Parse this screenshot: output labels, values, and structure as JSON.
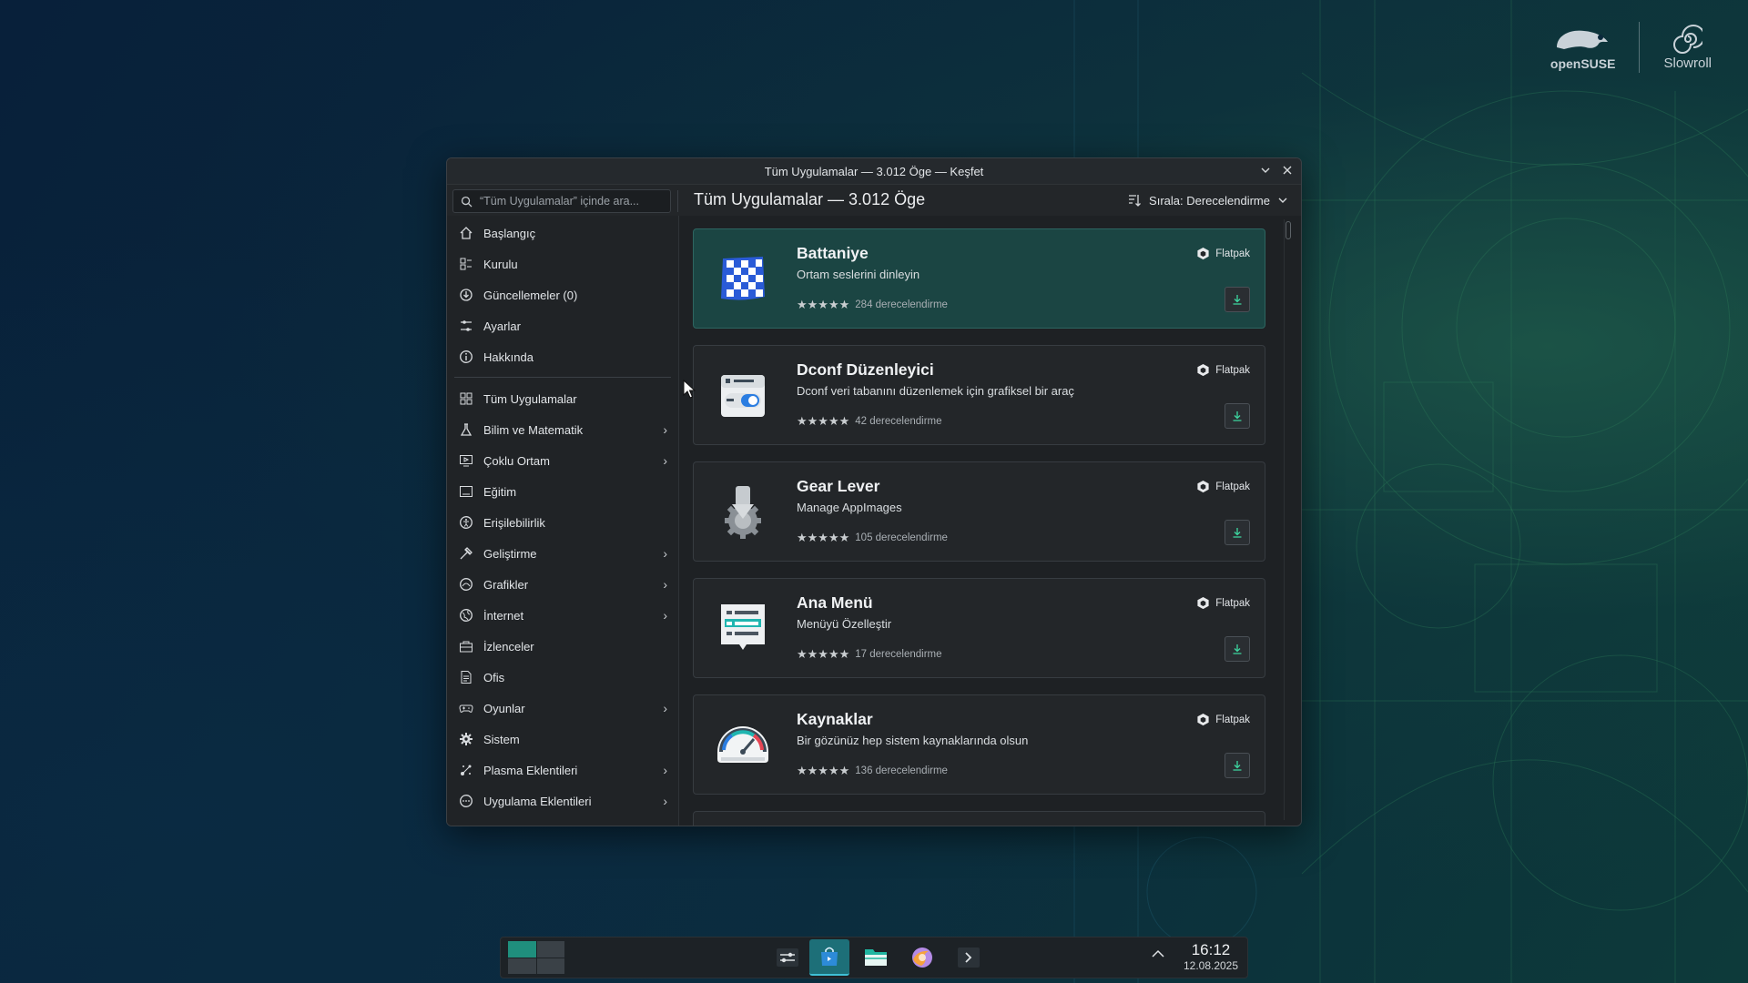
{
  "desktop": {
    "brand": {
      "opensuse": "openSUSE",
      "slowroll": "Slowroll"
    }
  },
  "window": {
    "title": "Tüm Uygulamalar — 3.012 Öge — Keşfet",
    "search_placeholder": "“Tüm Uygulamalar” içinde ara...",
    "heading": "Tüm Uygulamalar — 3.012 Öge",
    "sort_label": "Sırala: Derecelendirme"
  },
  "sidebar": {
    "top": [
      {
        "label": "Başlangıç",
        "icon": "home-icon"
      },
      {
        "label": "Kurulu",
        "icon": "installed-icon"
      },
      {
        "label": "Güncellemeler (0)",
        "icon": "updates-icon"
      },
      {
        "label": "Ayarlar",
        "icon": "settings-icon"
      },
      {
        "label": "Hakkında",
        "icon": "info-icon"
      }
    ],
    "categories": [
      {
        "label": "Tüm Uygulamalar",
        "icon": "grid-icon",
        "has_children": false
      },
      {
        "label": "Bilim ve Matematik",
        "icon": "flask-icon",
        "has_children": true
      },
      {
        "label": "Çoklu Ortam",
        "icon": "multimedia-icon",
        "has_children": true
      },
      {
        "label": "Eğitim",
        "icon": "education-icon",
        "has_children": false
      },
      {
        "label": "Erişilebilirlik",
        "icon": "accessibility-icon",
        "has_children": false
      },
      {
        "label": "Geliştirme",
        "icon": "hammer-icon",
        "has_children": true
      },
      {
        "label": "Grafikler",
        "icon": "graphics-icon",
        "has_children": true
      },
      {
        "label": "İnternet",
        "icon": "globe-icon",
        "has_children": true
      },
      {
        "label": "İzlenceler",
        "icon": "utilities-icon",
        "has_children": false
      },
      {
        "label": "Ofis",
        "icon": "office-icon",
        "has_children": false
      },
      {
        "label": "Oyunlar",
        "icon": "gamepad-icon",
        "has_children": true
      },
      {
        "label": "Sistem",
        "icon": "gear-icon",
        "has_children": false
      },
      {
        "label": "Plasma Eklentileri",
        "icon": "plasma-icon",
        "has_children": true
      },
      {
        "label": "Uygulama Eklentileri",
        "icon": "addons-icon",
        "has_children": true
      }
    ]
  },
  "apps": [
    {
      "name": "Battaniye",
      "summary": "Ortam seslerini dinleyin",
      "stars": 5,
      "ratings": "284 derecelendirme",
      "source": "Flatpak",
      "icon": "blanket-icon",
      "selected": true
    },
    {
      "name": "Dconf Düzenleyici",
      "summary": "Dconf veri tabanını düzenlemek için grafiksel bir araç",
      "stars": 5,
      "ratings": "42 derecelendirme",
      "source": "Flatpak",
      "icon": "dconf-icon",
      "selected": false
    },
    {
      "name": "Gear Lever",
      "summary": "Manage AppImages",
      "stars": 5,
      "ratings": "105 derecelendirme",
      "source": "Flatpak",
      "icon": "gear-lever-icon",
      "selected": false
    },
    {
      "name": "Ana Menü",
      "summary": "Menüyü Özelleştir",
      "stars": 5,
      "ratings": "17 derecelendirme",
      "source": "Flatpak",
      "icon": "menu-icon",
      "selected": false
    },
    {
      "name": "Kaynaklar",
      "summary": "Bir gözünüz hep sistem kaynaklarında olsun",
      "stars": 5,
      "ratings": "136 derecelendirme",
      "source": "Flatpak",
      "icon": "gauge-icon",
      "selected": false
    }
  ],
  "taskbar": {
    "time": "16:12",
    "date": "12.08.2025",
    "tasks": [
      "system-settings-icon",
      "discover-icon",
      "file-manager-icon",
      "browser-icon",
      "terminal-icon"
    ]
  },
  "colors": {
    "accent": "#3dd6a0",
    "selected_card": "#1b4543",
    "window_bg": "#1e2124"
  }
}
